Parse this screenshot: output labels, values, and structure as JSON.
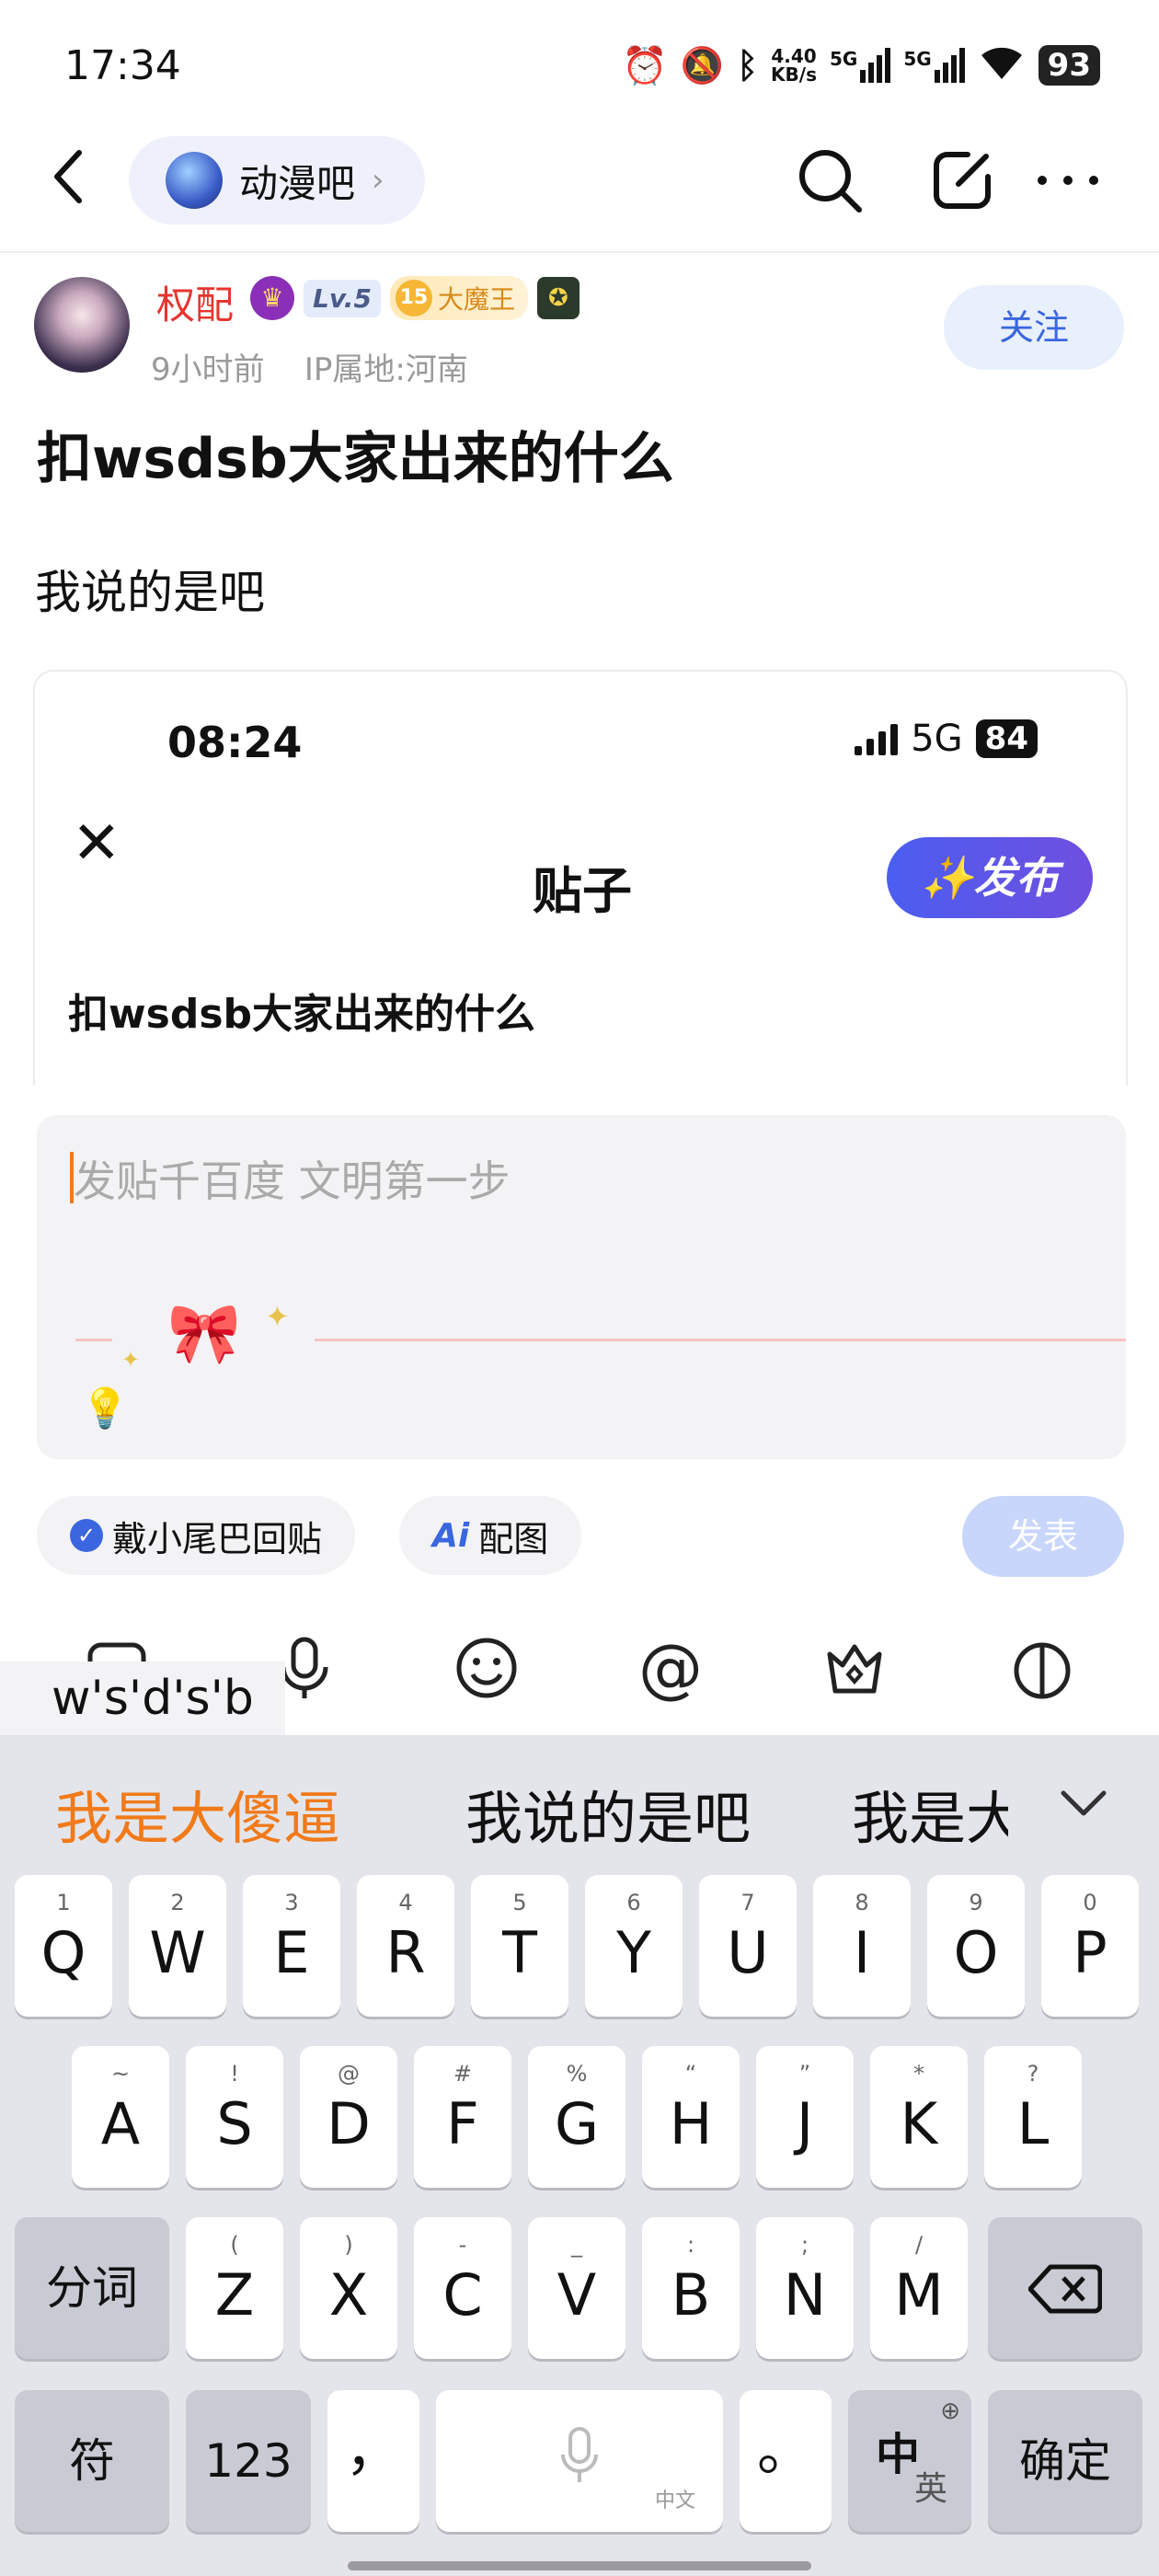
{
  "status_bar": {
    "time": "17:34",
    "net_speed_top": "4.40",
    "net_speed_bottom": "KB/s",
    "signal1": "5G",
    "signal2": "5G",
    "battery": "93",
    "icons": [
      "alarm-icon",
      "mute-icon",
      "bluetooth-icon",
      "signal-icon",
      "signal-icon",
      "wifi-icon"
    ]
  },
  "top_nav": {
    "back_icon": "chevron-left-icon",
    "forum_name": "动漫吧",
    "search_icon": "search-icon",
    "edit_icon": "edit-icon",
    "more_icon": "more-icon"
  },
  "author": {
    "name": "权配",
    "level": "Lv.5",
    "king_num": "15",
    "king_label": "大魔王",
    "time_ago": "9小时前",
    "ip_location": "IP属地:河南",
    "follow_label": "关注"
  },
  "post": {
    "title": "扣wsdsb大家出来的什么",
    "body": "我说的是吧"
  },
  "embedded_screenshot": {
    "time": "08:24",
    "network": "5G",
    "battery": "84",
    "heading": "贴子",
    "publish_label": "✨发布",
    "post_title": "扣wsdsb大家出来的什么"
  },
  "composer": {
    "placeholder": "发贴千百度 文明第一步",
    "tail_chip_label": "戴小尾巴回贴",
    "ai_chip_label": "配图",
    "ai_chip_prefix": "Ai",
    "send_label": "发表"
  },
  "toolbar": {
    "icons": [
      "image-icon",
      "mic-icon",
      "emoji-icon",
      "at-icon",
      "gift-icon",
      "vote-icon"
    ]
  },
  "ime": {
    "composing": "w's'd's'b",
    "candidates": [
      "我是大傻逼",
      "我说的是吧",
      "我是大"
    ],
    "rows": [
      [
        [
          "Q",
          "1"
        ],
        [
          "W",
          "2"
        ],
        [
          "E",
          "3"
        ],
        [
          "R",
          "4"
        ],
        [
          "T",
          "5"
        ],
        [
          "Y",
          "6"
        ],
        [
          "U",
          "7"
        ],
        [
          "I",
          "8"
        ],
        [
          "O",
          "9"
        ],
        [
          "P",
          "0"
        ]
      ],
      [
        [
          "A",
          "~"
        ],
        [
          "S",
          "!"
        ],
        [
          "D",
          "@"
        ],
        [
          "F",
          "#"
        ],
        [
          "G",
          "%"
        ],
        [
          "H",
          "“"
        ],
        [
          "J",
          "”"
        ],
        [
          "K",
          "*"
        ],
        [
          "L",
          "?"
        ]
      ],
      [
        [
          "Z",
          "("
        ],
        [
          "X",
          ")"
        ],
        [
          "C",
          "-"
        ],
        [
          "V",
          "_"
        ],
        [
          "B",
          ":"
        ],
        [
          "N",
          ";"
        ],
        [
          "M",
          "/"
        ]
      ]
    ],
    "fenci": "分词",
    "fu": "符",
    "num": "123",
    "comma": "，",
    "space_sub": "中文",
    "period": "。",
    "zh": "中",
    "en": "英",
    "confirm": "确定"
  }
}
